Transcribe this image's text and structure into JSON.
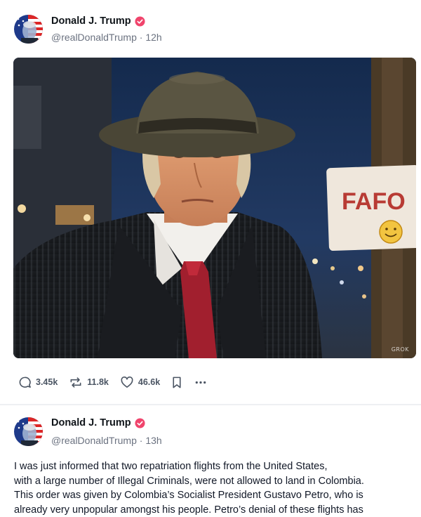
{
  "posts": [
    {
      "author": {
        "name": "Donald J. Trump",
        "handle": "@realDonaldTrump",
        "time": "12h"
      },
      "media": {
        "sign_text": "FAFO",
        "watermark": "GROK"
      },
      "stats": {
        "replies": "3.45k",
        "retruths": "11.8k",
        "likes": "46.6k"
      }
    },
    {
      "author": {
        "name": "Donald J. Trump",
        "handle": "@realDonaldTrump",
        "time": "13h"
      },
      "lines": [
        "I was just informed that two repatriation flights from the United States,",
        "with a large number of Illegal Criminals, were not allowed to land in Colombia.",
        "This order was given by Colombia’s Socialist President Gustavo Petro, who is",
        "already very unpopular amongst his people. Petro’s denial of these flights has"
      ]
    }
  ],
  "separator": "·",
  "colors": {
    "verified": "#f0446c",
    "muted": "#6b7280",
    "divider": "#eef0f3"
  }
}
